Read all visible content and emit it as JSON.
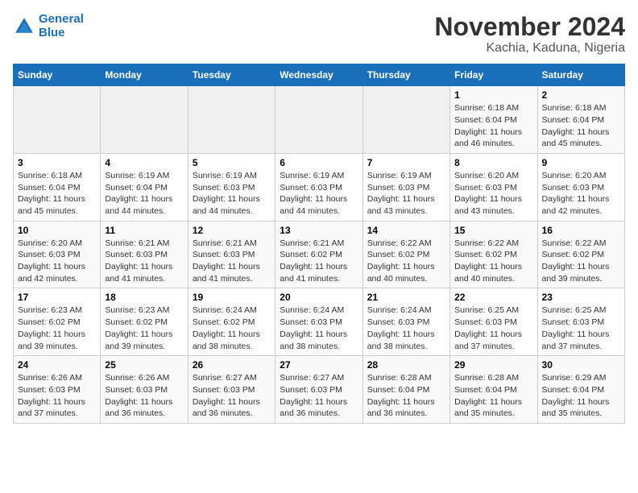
{
  "logo": {
    "line1": "General",
    "line2": "Blue"
  },
  "title": "November 2024",
  "subtitle": "Kachia, Kaduna, Nigeria",
  "weekdays": [
    "Sunday",
    "Monday",
    "Tuesday",
    "Wednesday",
    "Thursday",
    "Friday",
    "Saturday"
  ],
  "weeks": [
    [
      {
        "day": "",
        "info": ""
      },
      {
        "day": "",
        "info": ""
      },
      {
        "day": "",
        "info": ""
      },
      {
        "day": "",
        "info": ""
      },
      {
        "day": "",
        "info": ""
      },
      {
        "day": "1",
        "info": "Sunrise: 6:18 AM\nSunset: 6:04 PM\nDaylight: 11 hours and 46 minutes."
      },
      {
        "day": "2",
        "info": "Sunrise: 6:18 AM\nSunset: 6:04 PM\nDaylight: 11 hours and 45 minutes."
      }
    ],
    [
      {
        "day": "3",
        "info": "Sunrise: 6:18 AM\nSunset: 6:04 PM\nDaylight: 11 hours and 45 minutes."
      },
      {
        "day": "4",
        "info": "Sunrise: 6:19 AM\nSunset: 6:04 PM\nDaylight: 11 hours and 44 minutes."
      },
      {
        "day": "5",
        "info": "Sunrise: 6:19 AM\nSunset: 6:03 PM\nDaylight: 11 hours and 44 minutes."
      },
      {
        "day": "6",
        "info": "Sunrise: 6:19 AM\nSunset: 6:03 PM\nDaylight: 11 hours and 44 minutes."
      },
      {
        "day": "7",
        "info": "Sunrise: 6:19 AM\nSunset: 6:03 PM\nDaylight: 11 hours and 43 minutes."
      },
      {
        "day": "8",
        "info": "Sunrise: 6:20 AM\nSunset: 6:03 PM\nDaylight: 11 hours and 43 minutes."
      },
      {
        "day": "9",
        "info": "Sunrise: 6:20 AM\nSunset: 6:03 PM\nDaylight: 11 hours and 42 minutes."
      }
    ],
    [
      {
        "day": "10",
        "info": "Sunrise: 6:20 AM\nSunset: 6:03 PM\nDaylight: 11 hours and 42 minutes."
      },
      {
        "day": "11",
        "info": "Sunrise: 6:21 AM\nSunset: 6:03 PM\nDaylight: 11 hours and 41 minutes."
      },
      {
        "day": "12",
        "info": "Sunrise: 6:21 AM\nSunset: 6:03 PM\nDaylight: 11 hours and 41 minutes."
      },
      {
        "day": "13",
        "info": "Sunrise: 6:21 AM\nSunset: 6:02 PM\nDaylight: 11 hours and 41 minutes."
      },
      {
        "day": "14",
        "info": "Sunrise: 6:22 AM\nSunset: 6:02 PM\nDaylight: 11 hours and 40 minutes."
      },
      {
        "day": "15",
        "info": "Sunrise: 6:22 AM\nSunset: 6:02 PM\nDaylight: 11 hours and 40 minutes."
      },
      {
        "day": "16",
        "info": "Sunrise: 6:22 AM\nSunset: 6:02 PM\nDaylight: 11 hours and 39 minutes."
      }
    ],
    [
      {
        "day": "17",
        "info": "Sunrise: 6:23 AM\nSunset: 6:02 PM\nDaylight: 11 hours and 39 minutes."
      },
      {
        "day": "18",
        "info": "Sunrise: 6:23 AM\nSunset: 6:02 PM\nDaylight: 11 hours and 39 minutes."
      },
      {
        "day": "19",
        "info": "Sunrise: 6:24 AM\nSunset: 6:02 PM\nDaylight: 11 hours and 38 minutes."
      },
      {
        "day": "20",
        "info": "Sunrise: 6:24 AM\nSunset: 6:03 PM\nDaylight: 11 hours and 38 minutes."
      },
      {
        "day": "21",
        "info": "Sunrise: 6:24 AM\nSunset: 6:03 PM\nDaylight: 11 hours and 38 minutes."
      },
      {
        "day": "22",
        "info": "Sunrise: 6:25 AM\nSunset: 6:03 PM\nDaylight: 11 hours and 37 minutes."
      },
      {
        "day": "23",
        "info": "Sunrise: 6:25 AM\nSunset: 6:03 PM\nDaylight: 11 hours and 37 minutes."
      }
    ],
    [
      {
        "day": "24",
        "info": "Sunrise: 6:26 AM\nSunset: 6:03 PM\nDaylight: 11 hours and 37 minutes."
      },
      {
        "day": "25",
        "info": "Sunrise: 6:26 AM\nSunset: 6:03 PM\nDaylight: 11 hours and 36 minutes."
      },
      {
        "day": "26",
        "info": "Sunrise: 6:27 AM\nSunset: 6:03 PM\nDaylight: 11 hours and 36 minutes."
      },
      {
        "day": "27",
        "info": "Sunrise: 6:27 AM\nSunset: 6:03 PM\nDaylight: 11 hours and 36 minutes."
      },
      {
        "day": "28",
        "info": "Sunrise: 6:28 AM\nSunset: 6:04 PM\nDaylight: 11 hours and 36 minutes."
      },
      {
        "day": "29",
        "info": "Sunrise: 6:28 AM\nSunset: 6:04 PM\nDaylight: 11 hours and 35 minutes."
      },
      {
        "day": "30",
        "info": "Sunrise: 6:29 AM\nSunset: 6:04 PM\nDaylight: 11 hours and 35 minutes."
      }
    ]
  ]
}
